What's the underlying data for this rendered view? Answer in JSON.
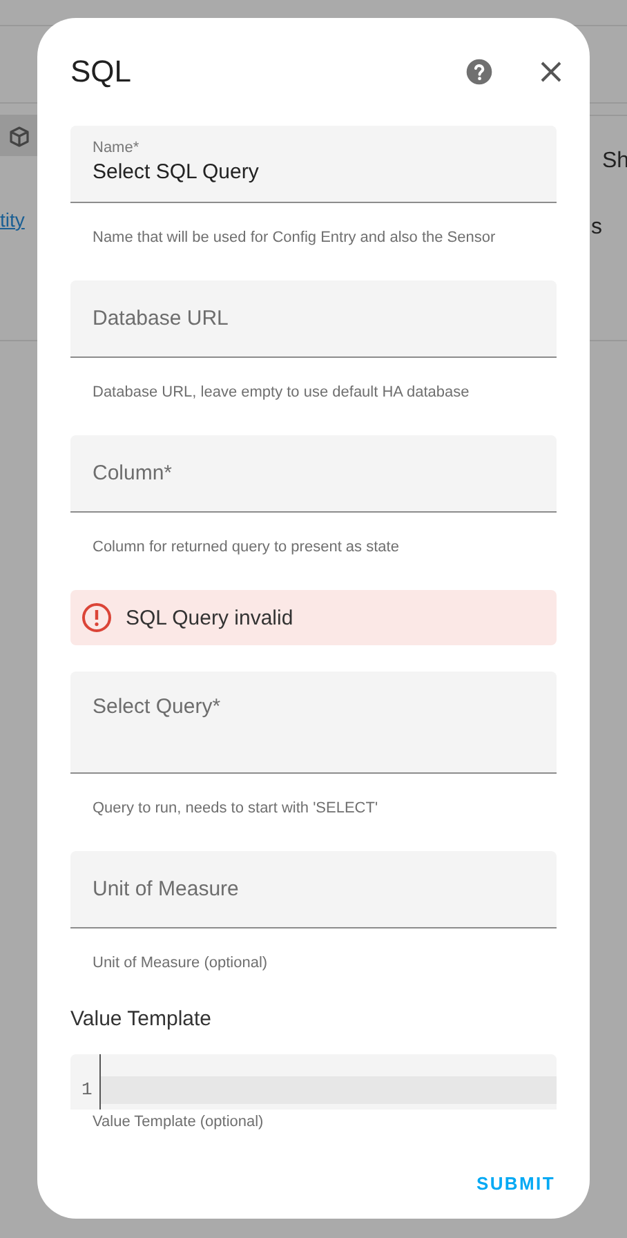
{
  "background": {
    "texts": [
      {
        "kind": "link",
        "text": "tity"
      },
      {
        "kind": "plain",
        "text": "Sh"
      },
      {
        "kind": "plain",
        "text": "s"
      }
    ]
  },
  "dialog": {
    "title": "SQL",
    "fields": [
      {
        "kind": "text",
        "label": "Name*",
        "value": "Select SQL Query",
        "helper": "Name that will be used for Config Entry and also the Sensor"
      },
      {
        "kind": "text",
        "label": "Database URL",
        "helper": "Database URL, leave empty to use default HA database"
      },
      {
        "kind": "text",
        "label": "Column*",
        "helper": "Column for returned query to present as state"
      },
      {
        "kind": "error",
        "text": "SQL Query invalid"
      },
      {
        "kind": "textarea",
        "label": "Select Query*",
        "helper": "Query to run, needs to start with 'SELECT'"
      },
      {
        "kind": "text",
        "label": "Unit of Measure",
        "helper": "Unit of Measure (optional)"
      },
      {
        "kind": "code",
        "label": "Value Template",
        "line_number": "1",
        "helper": "Value Template (optional)"
      }
    ],
    "submit": "SUBMIT"
  }
}
